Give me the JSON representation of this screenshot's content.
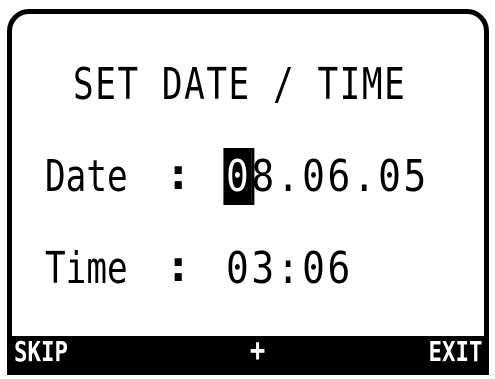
{
  "screen": {
    "title": "SET DATE / TIME",
    "date": {
      "label": "Date",
      "separator": ":",
      "cursor_char": "0",
      "rest": "8.06.05"
    },
    "time": {
      "label": "Time",
      "separator": ":",
      "value": "03:06"
    }
  },
  "softkeys": {
    "left": "SKIP",
    "center": "+",
    "right": "EXIT"
  },
  "colors": {
    "background": "#ffffff",
    "foreground": "#000000"
  }
}
